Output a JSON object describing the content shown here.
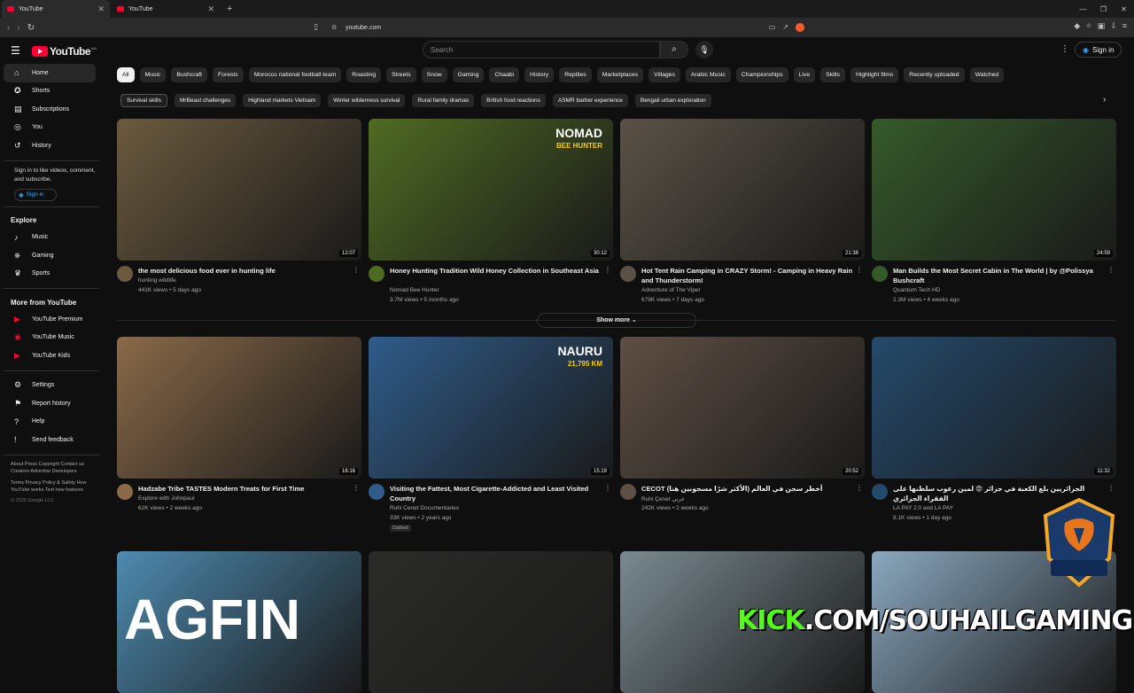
{
  "browser": {
    "tabs": [
      {
        "title": "YouTube",
        "active": true
      },
      {
        "title": "YouTube",
        "active": false
      }
    ],
    "url": "youtube.com"
  },
  "header": {
    "logo": "YouTube",
    "logo_cc": "MA",
    "search_placeholder": "Search",
    "signin_label": "Sign in"
  },
  "sidebar": {
    "main": [
      {
        "label": "Home",
        "icon": "home-icon",
        "active": true
      },
      {
        "label": "Shorts",
        "icon": "shorts-icon"
      },
      {
        "label": "Subscriptions",
        "icon": "subscriptions-icon"
      }
    ],
    "you": [
      {
        "label": "You",
        "icon": "you-icon"
      },
      {
        "label": "History",
        "icon": "history-icon"
      }
    ],
    "signin_note": "Sign in to like videos, comment, and subscribe.",
    "signin_label": "Sign in",
    "explore_title": "Explore",
    "explore": [
      {
        "label": "Music",
        "icon": "music-icon"
      },
      {
        "label": "Gaming",
        "icon": "gaming-icon"
      },
      {
        "label": "Sports",
        "icon": "trophy-icon"
      }
    ],
    "more_title": "More from YouTube",
    "more": [
      {
        "label": "YouTube Premium",
        "icon": "youtube-premium-icon"
      },
      {
        "label": "YouTube Music",
        "icon": "youtube-music-icon"
      },
      {
        "label": "YouTube Kids",
        "icon": "youtube-kids-icon"
      }
    ],
    "settings": [
      {
        "label": "Settings",
        "icon": "gear-icon"
      },
      {
        "label": "Report history",
        "icon": "flag-icon"
      },
      {
        "label": "Help",
        "icon": "help-icon"
      },
      {
        "label": "Send feedback",
        "icon": "feedback-icon"
      }
    ],
    "links1": "About  Press  Copyright  Contact us  Creators  Advertise  Developers",
    "links2": "Terms  Privacy  Policy & Safety  How YouTube works  Test new features",
    "copyright": "© 2025 Google LLC"
  },
  "chips": [
    "All",
    "Music",
    "Bushcraft",
    "Forests",
    "Morocco national football team",
    "Roasting",
    "Streets",
    "Snow",
    "Gaming",
    "Chaabi",
    "History",
    "Reptiles",
    "Marketplaces",
    "Villages",
    "Arabic Music",
    "Championships",
    "Live",
    "Skills",
    "Highlight films",
    "Recently uploaded",
    "Watched"
  ],
  "chips2": [
    "Survival skills",
    "MrBeast challenges",
    "Highland markets Vietnam",
    "Winter wilderness survival",
    "Rural family dramas",
    "British food reactions",
    "ASMR barber experience",
    "Bengali urban exploration"
  ],
  "show_more": "Show more",
  "videos": [
    {
      "title": "the most delicious food ever in hunting life",
      "channel": "hunting wildlife",
      "stats": "441K views • 5 days ago",
      "duration": "12:07",
      "thumb": "#6b5a3e"
    },
    {
      "title": "Honey Hunting Tradition Wild Honey Collection in Southeast Asia",
      "channel": "Nomad Bee Hunter",
      "stats": "3.7M views • 5 months ago",
      "duration": "30:12",
      "thumb": "#4f6b22",
      "overlay": "NOMAD",
      "overlay2": "BEE HUNTER"
    },
    {
      "title": "Hot Tent Rain Camping in CRAZY Storm! - Camping in Heavy Rain and Thunderstorm!",
      "channel": "Adventure of The Viper",
      "stats": "679K views • 7 days ago",
      "duration": "21:38",
      "thumb": "#5a5246"
    },
    {
      "title": "Man Builds the Most Secret Cabin in The World | by @Polissya Bushcraft",
      "channel": "Quantum Tech HD",
      "stats": "2.3M views • 4 weeks ago",
      "duration": "24:59",
      "thumb": "#355a2a"
    },
    {
      "title": "Hadzabe Tribe TASTES Modern Treats for First Time",
      "channel": "Explore with Johnpaul",
      "stats": "62K views • 2 weeks ago",
      "duration": "16:16",
      "thumb": "#8a6a48"
    },
    {
      "title": "Visiting the Fattest, Most Cigarette-Addicted and Least Visited Country",
      "channel": "Ruhi Cenet Documentaries",
      "stats": "33K views • 2 years ago",
      "duration": "15:19",
      "thumb": "#2f5c8a",
      "overlay": "NAURU",
      "overlay2": "21,795 KM",
      "badge": "Dubbed"
    },
    {
      "title": "CECOT (الأكثر شرًا مسجونين هنا) أخطر سجن في العالم",
      "channel": "Ruhi Çenet عربي",
      "stats": "242K views • 2 weeks ago",
      "duration": "20:52",
      "thumb": "#5e4f44"
    },
    {
      "title": "الجزائريين بلع الكعبة في جزائر 😡 لمين رعوب سلطنها على الفقراء الجزائري",
      "channel": "LA PAY 2.0 and LA PAY",
      "stats": "8.1K views • 1 day ago",
      "duration": "11:32",
      "thumb": "#244a6b"
    },
    {
      "title": "",
      "channel": "",
      "stats": "",
      "duration": "",
      "thumb": "#4d8bb0",
      "overlay": "AGFIN"
    },
    {
      "title": "",
      "channel": "",
      "stats": "",
      "duration": "",
      "thumb": "#2b2b28"
    },
    {
      "title": "",
      "channel": "",
      "stats": "",
      "duration": "",
      "thumb": "#7a8a90"
    },
    {
      "title": "",
      "channel": "",
      "stats": "",
      "duration": "",
      "thumb": "#8aa8bf"
    }
  ],
  "overlay_text": {
    "kick": "KICK",
    "rest": ".COM/SOUHAILGAMING",
    "logo": "SOUHAIL GAMING"
  },
  "colors": {
    "accent": "#ff0033",
    "link": "#3ea6ff",
    "bg": "#0f0f0f"
  }
}
